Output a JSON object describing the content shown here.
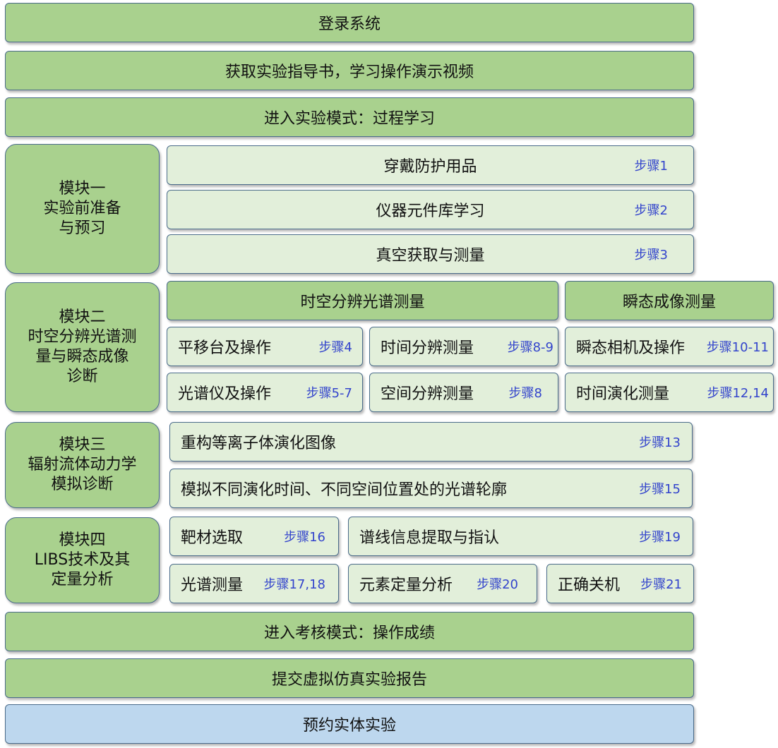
{
  "top": {
    "login": "登录系统",
    "guide": "获取实验指导书，学习操作演示视频",
    "process_mode": "进入实验模式：过程学习"
  },
  "module1": {
    "title": [
      "模块一",
      "实验前准备",
      "与预习"
    ],
    "steps": [
      {
        "label": "穿戴防护用品",
        "step": "步骤1"
      },
      {
        "label": "仪器元件库学习",
        "step": "步骤2"
      },
      {
        "label": "真空获取与测量",
        "step": "步骤3"
      }
    ]
  },
  "module2": {
    "title": [
      "模块二",
      "时空分辨光谱测",
      "量与瞬态成像",
      "诊断"
    ],
    "header_left": "时空分辨光谱测量",
    "header_right": "瞬态成像测量",
    "translation_stage": {
      "label": "平移台及操作",
      "step": "步骤4"
    },
    "time_resolved": {
      "label": "时间分辨测量",
      "step": "步骤8-9"
    },
    "transient_camera": {
      "label": "瞬态相机及操作",
      "step": "步骤10-11"
    },
    "spectrometer": {
      "label": "光谱仪及操作",
      "step": "步骤5-7"
    },
    "space_resolved": {
      "label": "空间分辨测量",
      "step": "步骤8"
    },
    "time_evolution": {
      "label": "时间演化测量",
      "step": "步骤12,14"
    }
  },
  "module3": {
    "title": [
      "模块三",
      "辐射流体动力学",
      "模拟诊断"
    ],
    "reconstruct": {
      "label": "重构等离子体演化图像",
      "step": "步骤13"
    },
    "simulate": {
      "label": "模拟不同演化时间、不同空间位置处的光谱轮廓",
      "step": "步骤15"
    }
  },
  "module4": {
    "title": [
      "模块四",
      "LIBS技术及其",
      "定量分析"
    ],
    "target": {
      "label": "靶材选取",
      "step": "步骤16"
    },
    "line_info": {
      "label": "谱线信息提取与指认",
      "step": "步骤19"
    },
    "spectral": {
      "label": "光谱测量",
      "step": "步骤17,18"
    },
    "element": {
      "label": "元素定量分析",
      "step": "步骤20"
    },
    "shutdown": {
      "label": "正确关机",
      "step": "步骤21"
    }
  },
  "bottom": {
    "assess_mode": "进入考核模式：操作成绩",
    "report": "提交虚拟仿真实验报告",
    "reserve": "预约实体实验"
  },
  "colors": {
    "dark_green": "#a9d18e",
    "light_green": "#e2efda",
    "light_blue": "#bdd7ee",
    "step_text": "#3344cc",
    "border": "#4a6b8a"
  }
}
